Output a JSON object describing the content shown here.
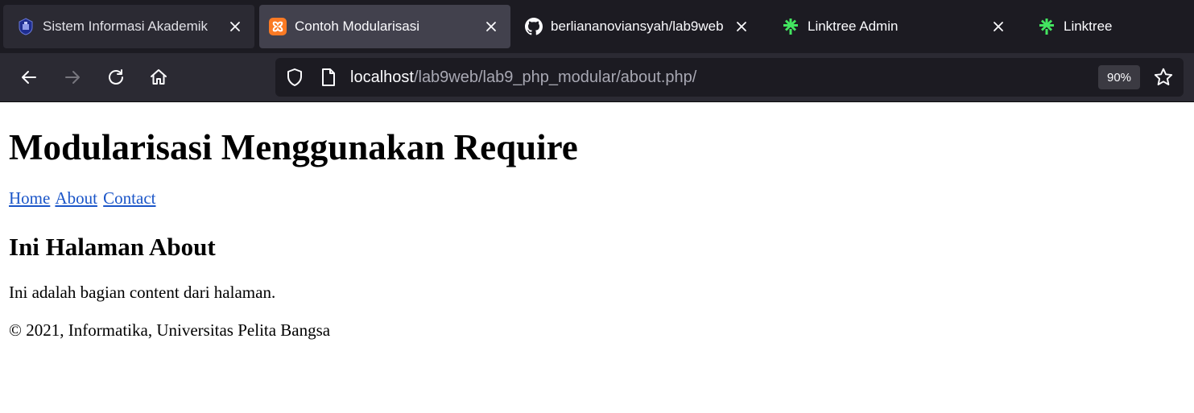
{
  "tabs": [
    {
      "title": "Sistem Informasi Akademik",
      "icon": "university-logo-icon",
      "state": "inactive"
    },
    {
      "title": "Contoh Modularisasi",
      "icon": "xampp-icon",
      "state": "active"
    },
    {
      "title": "berliananoviansyah/lab9web",
      "icon": "github-icon",
      "state": "inactive"
    },
    {
      "title": "Linktree Admin",
      "icon": "linktree-icon",
      "state": "inactive"
    },
    {
      "title": "Linktree",
      "icon": "linktree-icon",
      "state": "inactive"
    }
  ],
  "toolbar": {
    "url_host": "localhost",
    "url_path": "/lab9web/lab9_php_modular/about.php/",
    "zoom": "90%"
  },
  "page": {
    "heading": "Modularisasi Menggunakan Require",
    "nav": [
      "Home",
      "About",
      "Contact"
    ],
    "subheading": "Ini Halaman About",
    "paragraph": "Ini adalah bagian content dari halaman.",
    "footer": "© 2021, Informatika, Universitas Pelita Bangsa"
  },
  "colors": {
    "tabstrip_bg": "#1c1b22",
    "active_tab_bg": "#42414d",
    "toolbar_bg": "#2b2a33",
    "link": "#1a55c8",
    "linktree_green": "#43e660",
    "xampp_orange": "#fb7a24"
  }
}
